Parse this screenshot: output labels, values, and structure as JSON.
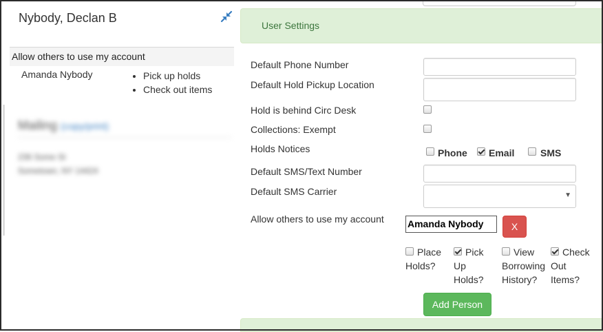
{
  "patron": {
    "name": "Nybody, Declan B",
    "delegates_header": "Allow others to use my account",
    "delegate_name": "Amanda Nybody",
    "delegate_permissions": [
      "Pick up holds",
      "Check out items"
    ]
  },
  "mailing": {
    "title": "Mailing",
    "link": "(copy/print)",
    "address_line1": "236 Some St",
    "address_line2": "Sometown, NY 14424"
  },
  "settings": {
    "title": "User Settings",
    "labels": {
      "phone": "Default Phone Number",
      "pickup": "Default Hold Pickup Location",
      "behind_desk": "Hold is behind Circ Desk",
      "collections": "Collections: Exempt",
      "notices": "Holds Notices",
      "sms_number": "Default SMS/Text Number",
      "sms_carrier": "Default SMS Carrier",
      "allow_others": "Allow others to use my account"
    },
    "notices": {
      "phone": "Phone",
      "email": "Email",
      "sms": "SMS",
      "phone_checked": false,
      "email_checked": true,
      "sms_checked": false
    },
    "behind_desk_checked": false,
    "collections_checked": false,
    "delegate_value": "Amanda Nybody",
    "remove_label": "X",
    "permissions": {
      "place_holds": [
        "Place",
        "Holds?"
      ],
      "pickup_holds": [
        "Pick",
        "Up",
        "Holds?"
      ],
      "view_history": [
        "View",
        "Borrowing",
        "History?"
      ],
      "checkout": [
        "Check",
        "Out",
        "Items?"
      ],
      "place_holds_checked": false,
      "pickup_holds_checked": true,
      "view_history_checked": false,
      "checkout_checked": true
    },
    "add_person_label": "Add Person"
  },
  "colors": {
    "panel_green_bg": "#dff0d8",
    "panel_green_text": "#3c763d",
    "danger": "#d9534f",
    "success": "#5cb85c"
  },
  "icons": {
    "collapse": "compress-arrows-icon"
  }
}
